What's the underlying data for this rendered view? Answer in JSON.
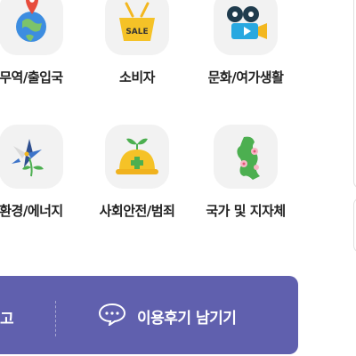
{
  "categories": [
    {
      "label": "무역/출입국",
      "icon": "globe-pin-icon"
    },
    {
      "label": "소비자",
      "icon": "sale-basket-icon"
    },
    {
      "label": "문화/여가생활",
      "icon": "movie-camera-icon"
    },
    {
      "label": "환경/에너지",
      "icon": "pinwheel-flower-icon"
    },
    {
      "label": "사회안전/범죄",
      "icon": "safety-helmet-sprout-icon"
    },
    {
      "label": "국가 및 지자체",
      "icon": "korea-map-flower-icon"
    }
  ],
  "sale_text": "SALE",
  "bottom_bar": {
    "left_label": "고",
    "review_label": "이용후기 남기기",
    "icon": "chat-bubble-icon"
  },
  "colors": {
    "bar": "#6060ae",
    "tile": "#f2f2f2"
  }
}
